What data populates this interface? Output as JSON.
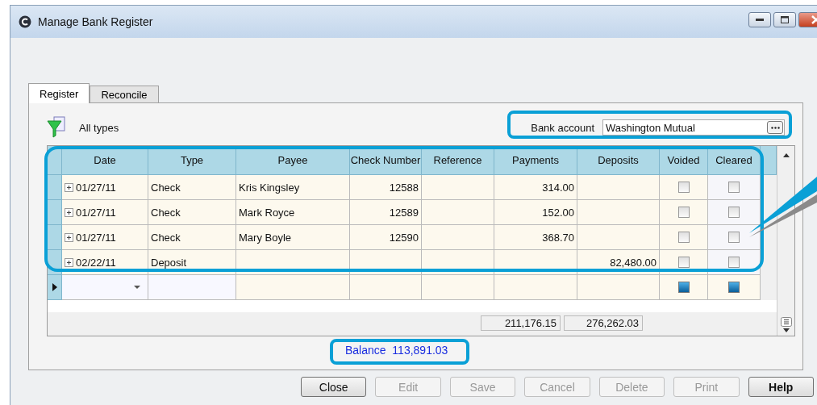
{
  "window": {
    "title": "Manage Bank Register"
  },
  "tabs": [
    {
      "label": "Register",
      "selected": true
    },
    {
      "label": "Reconcile",
      "selected": false
    }
  ],
  "filter": {
    "label": "All types"
  },
  "bank_account": {
    "label": "Bank account",
    "value": "Washington Mutual"
  },
  "table": {
    "columns": [
      "Date",
      "Type",
      "Payee",
      "Check Number",
      "Reference",
      "Payments",
      "Deposits",
      "Voided",
      "Cleared"
    ],
    "rows": [
      {
        "date": "01/27/11",
        "type": "Check",
        "payee": "Kris Kingsley",
        "check_number": "12588",
        "reference": "",
        "payments": "314.00",
        "deposits": "",
        "expanded": false,
        "voided": false,
        "cleared": false,
        "current": false
      },
      {
        "date": "01/27/11",
        "type": "Check",
        "payee": "Mark Royce",
        "check_number": "12589",
        "reference": "",
        "payments": "152.00",
        "deposits": "",
        "expanded": false,
        "voided": false,
        "cleared": false,
        "current": false
      },
      {
        "date": "01/27/11",
        "type": "Check",
        "payee": "Mary Boyle",
        "check_number": "12590",
        "reference": "",
        "payments": "368.70",
        "deposits": "",
        "expanded": false,
        "voided": false,
        "cleared": false,
        "current": false
      },
      {
        "date": "02/22/11",
        "type": "Deposit",
        "payee": "",
        "check_number": "",
        "reference": "",
        "payments": "",
        "deposits": "82,480.00",
        "expanded": false,
        "voided": false,
        "cleared": false,
        "current": false
      }
    ],
    "new_row": {
      "current": true
    },
    "totals": {
      "payments": "211,176.15",
      "deposits": "276,262.03"
    }
  },
  "balance": {
    "label": "Balance",
    "value": "113,891.03"
  },
  "buttons": [
    {
      "label": "Close",
      "disabled": false,
      "bold": false
    },
    {
      "label": "Edit",
      "disabled": true,
      "bold": false
    },
    {
      "label": "Save",
      "disabled": true,
      "bold": false
    },
    {
      "label": "Cancel",
      "disabled": true,
      "bold": false
    },
    {
      "label": "Delete",
      "disabled": true,
      "bold": false
    },
    {
      "label": "Print",
      "disabled": true,
      "bold": false
    },
    {
      "label": "Help",
      "disabled": false,
      "bold": true
    }
  ]
}
